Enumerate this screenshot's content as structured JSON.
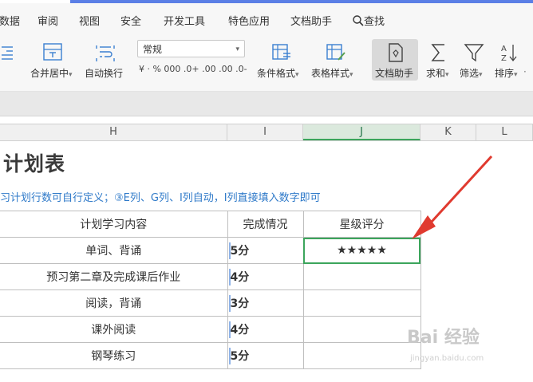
{
  "menu": {
    "items": [
      "数据",
      "审阅",
      "视图",
      "安全",
      "开发工具",
      "特色应用",
      "文档助手",
      "查找"
    ]
  },
  "ribbon": {
    "merge_center": "合并居中",
    "auto_wrap": "自动换行",
    "number_format": "常规",
    "num_tools": "¥ · % 000 .0+ .00 .00 .0-",
    "cond_format": "条件格式",
    "table_style": "表格样式",
    "doc_assistant": "文档助手",
    "sum": "求和",
    "filter": "筛选",
    "sort": "排序",
    "dropdown_mark": "·"
  },
  "columns": [
    {
      "label": "H",
      "selected": false
    },
    {
      "label": "I",
      "selected": false
    },
    {
      "label": "J",
      "selected": true
    },
    {
      "label": "K",
      "selected": false
    },
    {
      "label": "L",
      "selected": false
    }
  ],
  "sheet": {
    "title": "计划表",
    "note": "习计划行数可自行定义；③E列、G列、I列自动，I列直接填入数字即可",
    "headers": [
      "计划学习内容",
      "完成情况",
      "星级评分"
    ],
    "rows": [
      {
        "content": "单词、背诵",
        "score": "5分",
        "stars": "★★★★★"
      },
      {
        "content": "预习第二章及完成课后作业",
        "score": "4分",
        "stars": ""
      },
      {
        "content": "阅读，背诵",
        "score": "3分",
        "stars": ""
      },
      {
        "content": "课外阅读",
        "score": "4分",
        "stars": ""
      },
      {
        "content": "钢琴练习",
        "score": "5分",
        "stars": ""
      }
    ]
  },
  "colors": {
    "accent": "#5b7fe6",
    "selection": "#3ca55c",
    "arrow": "#e03a2f",
    "score_text": "#3b67b3"
  },
  "watermark": {
    "main": "Bai 经验",
    "sub": "jingyan.baidu.com"
  }
}
